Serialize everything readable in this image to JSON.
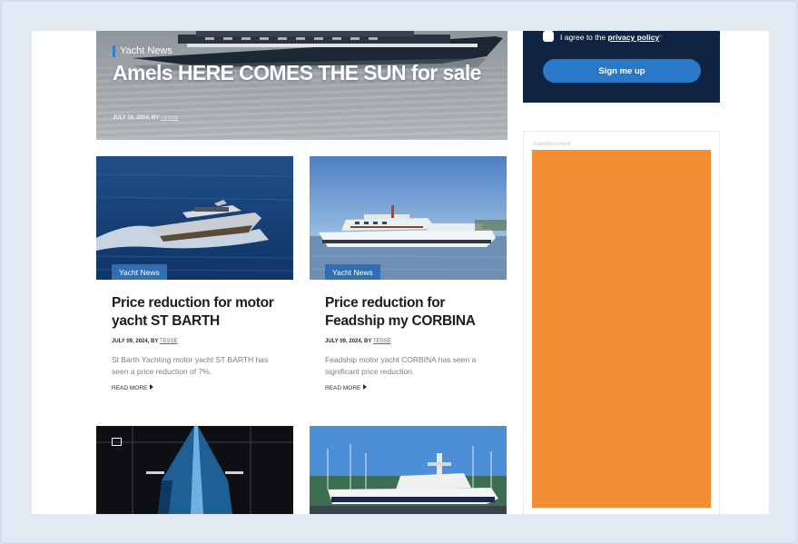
{
  "hero": {
    "tag": "Yacht News",
    "title": "Amels HERE COMES THE SUN for sale",
    "date": "JULY 10, 2024",
    "by": ", BY",
    "author": "TESSE"
  },
  "cards": [
    {
      "tag": "Yacht News",
      "title": "Price reduction for motor yacht ST BARTH",
      "date": "JULY 09, 2024",
      "by": ", BY",
      "author": "TESSE",
      "excerpt": "St Barth Yachting motor yacht ST BARTH has seen a price reduction of 7%.",
      "read_more": "READ MORE"
    },
    {
      "tag": "Yacht News",
      "title": "Price reduction for Feadship my CORBINA",
      "date": "JULY 09, 2024",
      "by": ", BY",
      "author": "TESSE",
      "excerpt": "Feadship motor yacht CORBINA has seen a significant price reduction.",
      "read_more": "READ MORE"
    }
  ],
  "newsletter": {
    "agree_text": "I agree to the",
    "privacy_link": "privacy policy",
    "required_mark": "*",
    "button": "Sign me up"
  },
  "advertisement": {
    "label": "Advertisement",
    "color": "#f48e34"
  },
  "colors": {
    "tag_bg": "#2f6fb0",
    "sidebar_bg": "#0f2440",
    "button": "#2a78c8"
  }
}
